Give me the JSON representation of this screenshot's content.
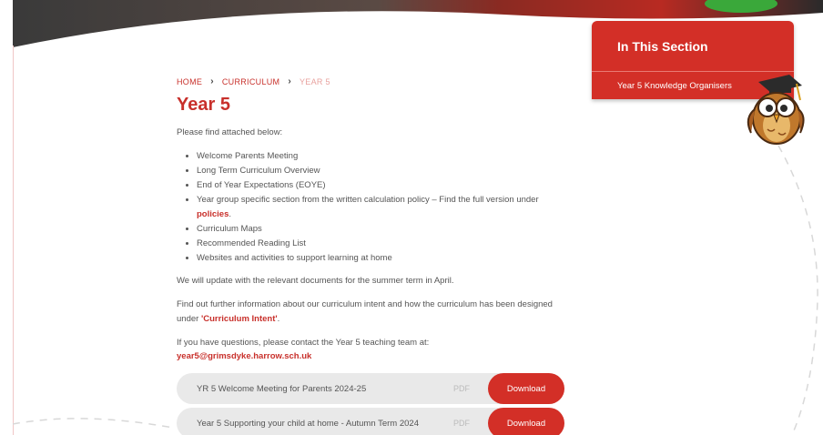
{
  "breadcrumb": {
    "home": "HOME",
    "curriculum": "CURRICULUM",
    "current": "YEAR 5"
  },
  "page_title": "Year 5",
  "intro": "Please find attached below:",
  "list_items": {
    "item1": "Welcome Parents Meeting",
    "item2": "Long Term Curriculum Overview",
    "item3": "End of Year Expectations (EOYE)",
    "item4_text": "Year group specific section from the written calculation policy – Find the full version under",
    "item4_link": "policies",
    "item4_end": ".",
    "item5": "Curriculum Maps",
    "item6": "Recommended Reading List",
    "item7": "Websites and activities to support learning at home"
  },
  "update_note": "We will update with the relevant documents for the summer term in April.",
  "curriculum_intent": {
    "text": "Find out further information about our curriculum intent and how the curriculum has been designed under",
    "link": "'Curriculum Intent'",
    "end": "."
  },
  "contact_text": "If you have questions, please contact the Year 5 teaching team at:",
  "email": "year5@grimsdyke.harrow.sch.uk",
  "downloads": {
    "d1": {
      "name": "YR 5 Welcome Meeting for Parents 2024-25",
      "type": "PDF",
      "button": "Download"
    },
    "d2": {
      "name": "Year 5 Supporting your child at home - Autumn Term 2024",
      "type": "PDF",
      "button": "Download"
    }
  },
  "sidebar": {
    "heading": "In This Section",
    "item": "Year 5 Knowledge Organisers"
  },
  "colors": {
    "brand_red": "#d32f27",
    "text_gray": "#555555",
    "row_bg": "#e9e9e9"
  },
  "icons": {
    "owl": "owl-mascot-icon",
    "separator": "chevron-right-icon"
  }
}
